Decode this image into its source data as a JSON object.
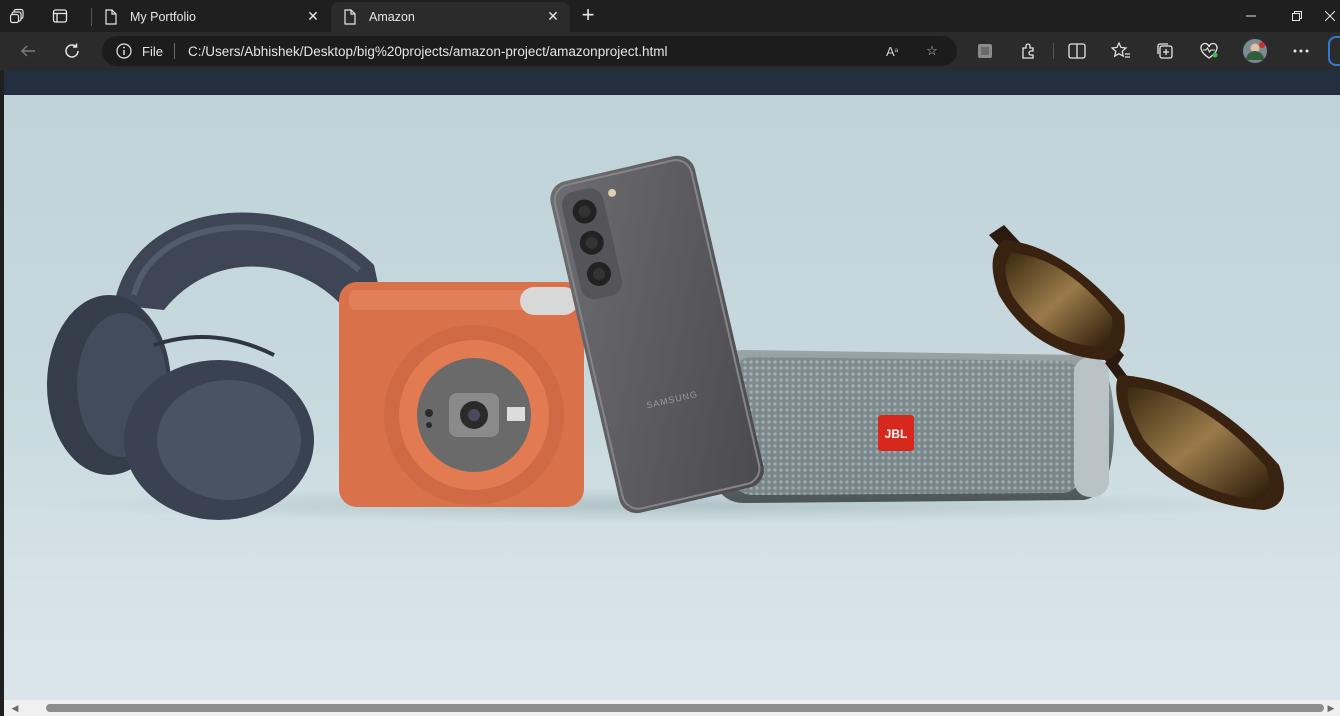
{
  "browser": {
    "tabs": [
      {
        "label": "My Portfolio",
        "active": false
      },
      {
        "label": "Amazon",
        "active": true
      }
    ],
    "address": {
      "scheme_label": "File",
      "url": "C:/Users/Abhishek/Desktop/big%20projects/amazon-project/amazonproject.html"
    }
  },
  "page": {
    "hero_image_alt": "Electronics products: headphones, instant camera, Samsung phone, JBL speaker, sunglasses",
    "phone_brand": "SAMSUNG",
    "speaker_brand": "JBL"
  },
  "colors": {
    "browser_dark": "#1f1f1f",
    "toolbar": "#2b2b2b",
    "amazon_nav": "#232f3e",
    "jbl_red": "#d7281e",
    "camera_orange": "#d9714b"
  }
}
